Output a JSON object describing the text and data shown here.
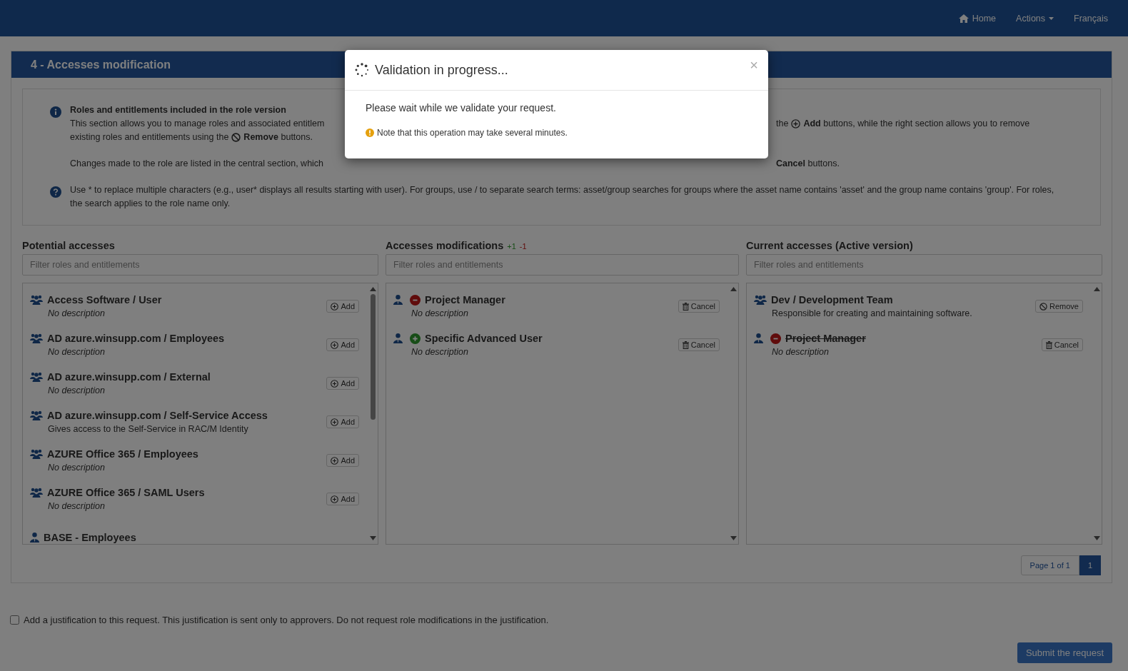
{
  "navbar": {
    "links": [
      {
        "kind": "home",
        "label": "Home"
      },
      {
        "kind": "dropdown",
        "label": "Actions"
      },
      {
        "kind": "plain",
        "label": "Français"
      }
    ]
  },
  "panel": {
    "title": "4 - Accesses modification",
    "info": {
      "title": "Roles and entitlements included in the role version",
      "paragraphs": [
        [
          {
            "left": [
              {
                "kind": "text",
                "text": "This section allows you to manage roles and associated entitlem"
              }
            ],
            "right": [
              {
                "kind": "text",
                "text": "the"
              },
              {
                "kind": "add"
              },
              {
                "kind": "text",
                "text": "**Add** buttons, while the right section allows you to remove"
              }
            ]
          },
          {
            "left": [
              {
                "kind": "text",
                "text": "existing roles and entitlements using the"
              },
              {
                "kind": "ban"
              },
              {
                "kind": "text",
                "text": "**Remove** buttons."
              }
            ]
          }
        ],
        [
          {
            "left": [
              {
                "kind": "text",
                "text": "Changes made to the role are listed in the central section, which"
              }
            ],
            "right": [
              {
                "kind": "text",
                "text": "**Cancel** buttons."
              }
            ]
          }
        ]
      ],
      "help": "Use * to replace multiple characters (e.g., user* displays all results starting with user). For groups, use / to separate search terms: asset/group searches for groups where the asset name contains 'asset' and the group name contains 'group'. For roles, the search applies to the role name only."
    },
    "columns": [
      {
        "title": "Potential accesses",
        "placeholder": "Filter roles and entitlements",
        "scrollbar": true,
        "items": [
          {
            "kind": "group",
            "name": "Access Software / User",
            "struck": false,
            "description": "No description",
            "italic": true,
            "button": {
              "kind": "add",
              "label": "Add"
            }
          },
          {
            "kind": "group",
            "name": "AD azure.winsupp.com / Employees",
            "struck": false,
            "description": "No description",
            "italic": true,
            "button": {
              "kind": "add",
              "label": "Add"
            }
          },
          {
            "kind": "group",
            "name": "AD azure.winsupp.com / External",
            "struck": false,
            "description": "No description",
            "italic": true,
            "button": {
              "kind": "add",
              "label": "Add"
            }
          },
          {
            "kind": "group",
            "name": "AD azure.winsupp.com / Self-Service Access",
            "struck": false,
            "description": "Gives access to the Self-Service in RAC/M Identity",
            "italic": false,
            "button": {
              "kind": "add",
              "label": "Add"
            }
          },
          {
            "kind": "group",
            "name": "AZURE Office 365 / Employees",
            "struck": false,
            "description": "No description",
            "italic": true,
            "button": {
              "kind": "add",
              "label": "Add"
            }
          },
          {
            "kind": "group",
            "name": "AZURE Office 365 / SAML Users",
            "struck": false,
            "description": "No description",
            "italic": true,
            "button": {
              "kind": "add",
              "label": "Add"
            }
          },
          {
            "kind": "user",
            "name": "BASE - Employees",
            "struck": false
          }
        ]
      },
      {
        "title": "Accesses modifications",
        "counts": [
          {
            "kind": "added",
            "text": "+1"
          },
          {
            "kind": "removed",
            "text": "-1"
          }
        ],
        "placeholder": "Filter roles and entitlements",
        "scrollbar": false,
        "items": [
          {
            "kind": "user",
            "added": false,
            "name": "Project Manager",
            "struck": false,
            "description": "No description",
            "italic": true,
            "button": {
              "kind": "cancel",
              "label": "Cancel"
            }
          },
          {
            "kind": "user",
            "added": true,
            "name": "Specific Advanced User",
            "struck": false,
            "description": "No description",
            "italic": true,
            "button": {
              "kind": "cancel",
              "label": "Cancel"
            }
          }
        ]
      },
      {
        "title": "Current accesses (Active version)",
        "placeholder": "Filter roles and entitlements",
        "scrollbar": false,
        "items": [
          {
            "kind": "group",
            "name": "Dev / Development Team",
            "struck": false,
            "description": "Responsible for creating and maintaining software.",
            "italic": false,
            "button": {
              "kind": "remove",
              "label": "Remove"
            }
          },
          {
            "kind": "user",
            "added": false,
            "name": "Project Manager",
            "struck": true,
            "description": "No description",
            "italic": true,
            "button": {
              "kind": "cancel",
              "label": "Cancel"
            }
          }
        ]
      }
    ],
    "pagination": {
      "summary": "Page 1 of 1",
      "pages": [
        {
          "label": "1",
          "selected": true
        }
      ]
    }
  },
  "justification": {
    "checked": false,
    "label": "Add a justification to this request. This justification is sent only to approvers. Do not request role modifications in the justification."
  },
  "submit": {
    "label": "Submit the request"
  },
  "modal": {
    "title": "Validation in progress...",
    "message": "Please wait while we validate your request.",
    "note": "Note that this operation may take several minutes.",
    "close": "×"
  }
}
